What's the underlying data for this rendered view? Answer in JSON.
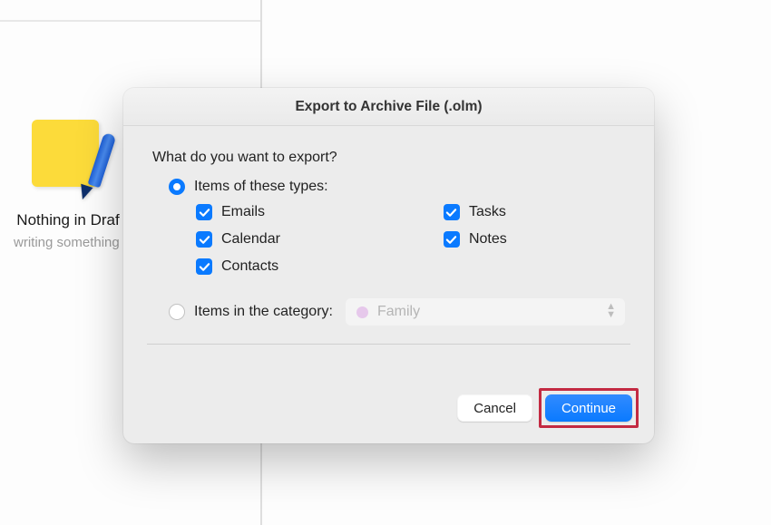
{
  "background": {
    "note_title": "Nothing in Draf",
    "note_subtitle": "writing something"
  },
  "dialog": {
    "title": "Export to Archive File (.olm)",
    "prompt": "What do you want to export?",
    "option_types": {
      "label": "Items of these types:",
      "selected": true,
      "checks_left": [
        {
          "label": "Emails",
          "checked": true
        },
        {
          "label": "Calendar",
          "checked": true
        },
        {
          "label": "Contacts",
          "checked": true
        }
      ],
      "checks_right": [
        {
          "label": "Tasks",
          "checked": true
        },
        {
          "label": "Notes",
          "checked": true
        }
      ]
    },
    "option_category": {
      "label": "Items in the category:",
      "selected": false,
      "value": "Family"
    },
    "buttons": {
      "cancel": "Cancel",
      "continue": "Continue"
    }
  }
}
